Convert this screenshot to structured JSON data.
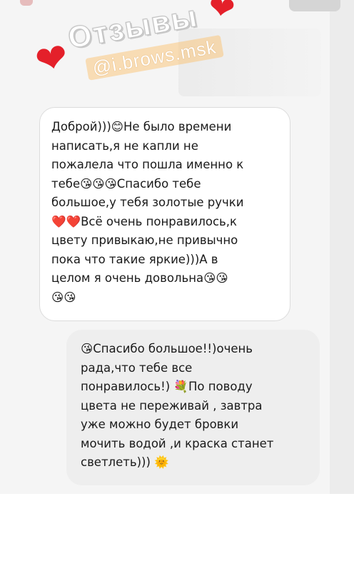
{
  "story": {
    "title": "Отзывы",
    "handle": "@i.brows.msk"
  },
  "messages": [
    {
      "direction": "incoming",
      "text": "Доброй)))😊Не было времени\nнаписать,я не капли не\nпожалела что пошла именно к\nтебе😘😘😘Спасибо тебе\nбольшое,у тебя золотые ручки\n❤️❤️Всё очень понравилось,к\nцвету привыкаю,не привычно\nпока что такие яркие)))А в\nцелом я очень довольна😘😘\n😘😘"
    },
    {
      "direction": "outgoing",
      "text": "😘Спасибо большое!!)очень\nрада,что тебе все\nпонравилось!) 💐По поводу\nцвета не переживай , завтра\nуже можно будет бровки\nмочить водой  ,и краска станет\nсветлеть)))  🌞"
    }
  ],
  "colors": {
    "heart": "#e4202a",
    "handle_highlight": "#fac67e",
    "incoming_bubble": "#ffffff",
    "outgoing_bubble": "#eeeeee"
  }
}
